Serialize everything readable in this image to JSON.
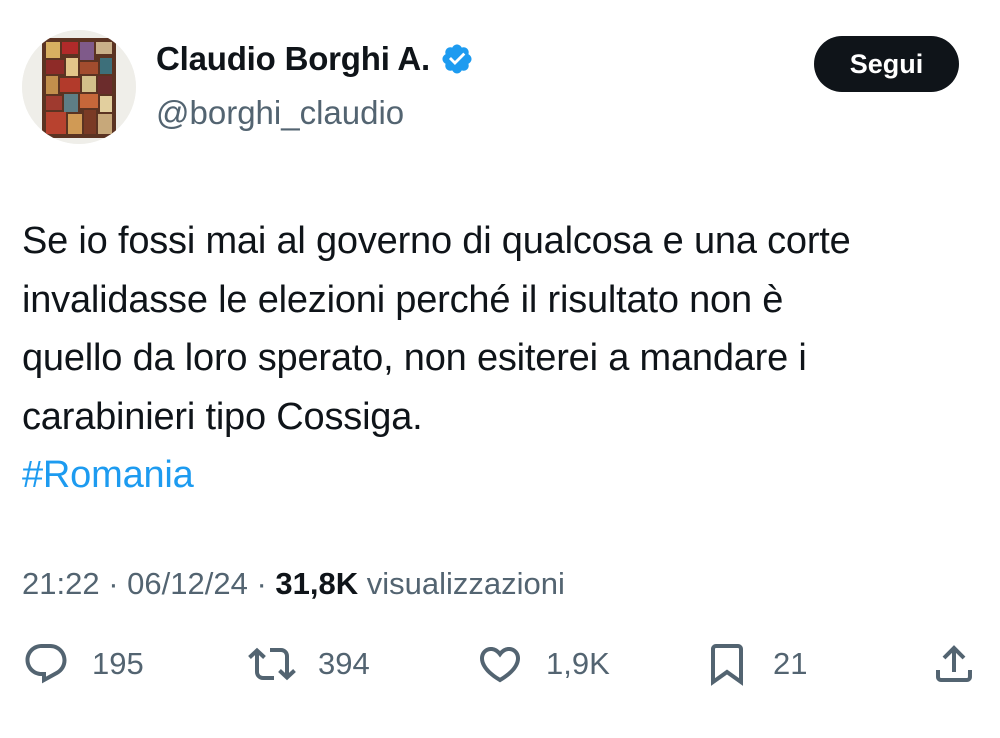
{
  "author": {
    "name": "Claudio Borghi A.",
    "handle": "@borghi_claudio",
    "verified_color": "#1d9bf0"
  },
  "follow_button": {
    "label": "Segui"
  },
  "tweet": {
    "lines": [
      "Se io fossi mai al governo di qualcosa e una corte",
      "invalidasse le elezioni perché il risultato non è",
      "quello da loro sperato, non esiterei a mandare i",
      "carabinieri tipo Cossiga."
    ],
    "hashtag": "#Romania"
  },
  "meta": {
    "time": "21:22",
    "separator": "·",
    "date": "06/12/24",
    "views_count": "31,8K",
    "views_label": "visualizzazioni"
  },
  "actions": {
    "reply": {
      "icon": "reply-icon",
      "count": "195"
    },
    "retweet": {
      "icon": "retweet-icon",
      "count": "394"
    },
    "like": {
      "icon": "heart-icon",
      "count": "1,9K"
    },
    "bookmark": {
      "icon": "bookmark-icon",
      "count": "21"
    },
    "share": {
      "icon": "share-icon"
    }
  },
  "colors": {
    "text": "#0f1419",
    "secondary": "#536471",
    "accent": "#1d9bf0",
    "button_bg": "#0f1419"
  }
}
